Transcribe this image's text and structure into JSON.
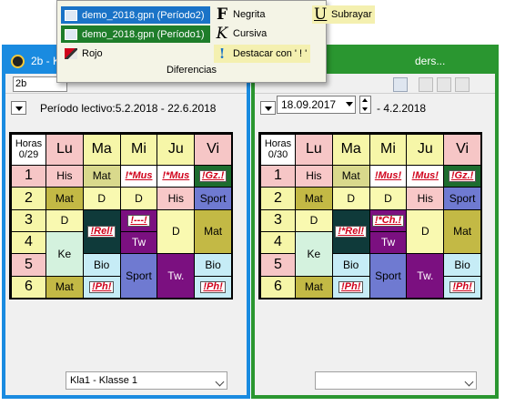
{
  "popup": {
    "files": [
      {
        "label": "demo_2018.gpn (Período2)",
        "bg": "#1a73c7"
      },
      {
        "label": "demo_2018.gpn (Período1)",
        "bg": "#1e7d2a"
      }
    ],
    "rojo_label": "Rojo",
    "formats": {
      "negrita": "Negrita",
      "cursiva": "Cursiva",
      "destacar": "Destacar con ' ! '",
      "subrayar": "Subrayar"
    },
    "icons": {
      "negrita": "F",
      "cursiva": "K",
      "subrayar": "U",
      "destacar": "!"
    },
    "caption": "Diferencias"
  },
  "left_window": {
    "title": "2b - K",
    "class_input": "2b",
    "period_text": "Período lectivo:5.2.2018 - 22.6.2018",
    "bottom_select": "Kla1 - Klasse 1",
    "accent": "#1a8be0"
  },
  "right_window": {
    "title": "ders...",
    "date_value": "18.09.2017",
    "date_suffix": "- 4.2.2018",
    "bottom_select": "",
    "accent": "#2a9630"
  },
  "timetable": {
    "days": [
      "Lu",
      "Ma",
      "Mi",
      "Ju",
      "Vi"
    ],
    "periods": [
      "1",
      "2",
      "3",
      "4",
      "5",
      "6"
    ],
    "day_colors": [
      "#f6c6c6",
      "#f6f6a8",
      "#f6f6a8",
      "#f6f6a8",
      "#f6c6c6"
    ],
    "period_colors": [
      "#f6c6c6",
      "#f6f6a8",
      "#f6f6a8",
      "#f6f6a8",
      "#f6c6c6",
      "#f6f6a8"
    ],
    "left_hours": "Horas\n0/29",
    "right_hours": "Horas\n0/30",
    "left_lessons": [
      {
        "day": 0,
        "start": 0,
        "span": 1,
        "text": "His",
        "bg": "#f8c8c8",
        "fg": "#000",
        "red": false
      },
      {
        "day": 1,
        "start": 0,
        "span": 1,
        "text": "Mat",
        "bg": "#d9d98c",
        "fg": "#000",
        "red": false
      },
      {
        "day": 2,
        "start": 0,
        "span": 1,
        "text": "!*Mus",
        "bg": "#ffffff",
        "fg": "#d0021b",
        "red": true
      },
      {
        "day": 3,
        "start": 0,
        "span": 1,
        "text": "!*Mus",
        "bg": "#ffffff",
        "fg": "#d0021b",
        "red": true
      },
      {
        "day": 4,
        "start": 0,
        "span": 1,
        "text": "!Gz.!",
        "bg": "#1d6d2f",
        "fg": "#d0021b",
        "red": true,
        "box": true
      },
      {
        "day": 0,
        "start": 1,
        "span": 1,
        "text": "Mat",
        "bg": "#c3b945",
        "fg": "#000",
        "red": false
      },
      {
        "day": 1,
        "start": 1,
        "span": 1,
        "text": "D",
        "bg": "#f9f9b0",
        "fg": "#000",
        "red": false
      },
      {
        "day": 2,
        "start": 1,
        "span": 1,
        "text": "D",
        "bg": "#f9f9b0",
        "fg": "#000",
        "red": false
      },
      {
        "day": 3,
        "start": 1,
        "span": 1,
        "text": "His",
        "bg": "#f8c8c8",
        "fg": "#000",
        "red": false
      },
      {
        "day": 4,
        "start": 1,
        "span": 1,
        "text": "Sport",
        "bg": "#6f7ad1",
        "fg": "#000",
        "red": false
      },
      {
        "day": 0,
        "start": 2,
        "span": 1,
        "text": "D",
        "bg": "#f9f9b0",
        "fg": "#000",
        "red": false
      },
      {
        "day": 1,
        "start": 2,
        "span": 2,
        "text": "!Rel!",
        "bg": "#0f3a3a",
        "fg": "#d0021b",
        "red": true,
        "box": true
      },
      {
        "day": 2,
        "start": 2,
        "span": 1,
        "text": "!---!",
        "bg": "#7b1080",
        "fg": "#d0021b",
        "red": true,
        "box": true
      },
      {
        "day": 3,
        "start": 2,
        "span": 2,
        "text": "D",
        "bg": "#f9f9b0",
        "fg": "#000",
        "red": false
      },
      {
        "day": 4,
        "start": 2,
        "span": 2,
        "text": "Mat",
        "bg": "#c3b945",
        "fg": "#000",
        "red": false
      },
      {
        "day": 0,
        "start": 3,
        "span": 2,
        "text": "Ke",
        "bg": "#d4f2de",
        "fg": "#000",
        "red": false
      },
      {
        "day": 2,
        "start": 3,
        "span": 1,
        "text": "Tw",
        "bg": "#7b1080",
        "fg": "#ffffff",
        "red": false
      },
      {
        "day": 1,
        "start": 4,
        "span": 1,
        "text": "Bio",
        "bg": "#c6ecf6",
        "fg": "#000",
        "red": false
      },
      {
        "day": 2,
        "start": 4,
        "span": 2,
        "text": "Sport",
        "bg": "#6f7ad1",
        "fg": "#000",
        "red": false
      },
      {
        "day": 3,
        "start": 4,
        "span": 2,
        "text": "Tw.",
        "bg": "#7b1080",
        "fg": "#ffffff",
        "red": false
      },
      {
        "day": 4,
        "start": 4,
        "span": 1,
        "text": "Bio",
        "bg": "#c6ecf6",
        "fg": "#000",
        "red": false
      },
      {
        "day": 0,
        "start": 5,
        "span": 1,
        "text": "Mat",
        "bg": "#c3b945",
        "fg": "#000",
        "red": false
      },
      {
        "day": 1,
        "start": 5,
        "span": 1,
        "text": "!Ph!",
        "bg": "#c6ecf6",
        "fg": "#d0021b",
        "red": true,
        "box": true
      },
      {
        "day": 4,
        "start": 5,
        "span": 1,
        "text": "!Ph!",
        "bg": "#c6ecf6",
        "fg": "#d0021b",
        "red": true,
        "box": true
      }
    ],
    "right_lessons": [
      {
        "day": 0,
        "start": 0,
        "span": 1,
        "text": "His",
        "bg": "#f8c8c8",
        "fg": "#000",
        "red": false
      },
      {
        "day": 1,
        "start": 0,
        "span": 1,
        "text": "Mat",
        "bg": "#d9d98c",
        "fg": "#000",
        "red": false
      },
      {
        "day": 2,
        "start": 0,
        "span": 1,
        "text": "!Mus!",
        "bg": "#ffffff",
        "fg": "#d0021b",
        "red": true
      },
      {
        "day": 3,
        "start": 0,
        "span": 1,
        "text": "!Mus!",
        "bg": "#ffffff",
        "fg": "#d0021b",
        "red": true
      },
      {
        "day": 4,
        "start": 0,
        "span": 1,
        "text": "!Gz.!",
        "bg": "#1d6d2f",
        "fg": "#d0021b",
        "red": true,
        "box": true
      },
      {
        "day": 0,
        "start": 1,
        "span": 1,
        "text": "Mat",
        "bg": "#c3b945",
        "fg": "#000",
        "red": false
      },
      {
        "day": 1,
        "start": 1,
        "span": 1,
        "text": "D",
        "bg": "#f9f9b0",
        "fg": "#000",
        "red": false
      },
      {
        "day": 2,
        "start": 1,
        "span": 1,
        "text": "D",
        "bg": "#f9f9b0",
        "fg": "#000",
        "red": false
      },
      {
        "day": 3,
        "start": 1,
        "span": 1,
        "text": "His",
        "bg": "#f8c8c8",
        "fg": "#000",
        "red": false
      },
      {
        "day": 4,
        "start": 1,
        "span": 1,
        "text": "Sport",
        "bg": "#6f7ad1",
        "fg": "#000",
        "red": false
      },
      {
        "day": 0,
        "start": 2,
        "span": 1,
        "text": "D",
        "bg": "#f9f9b0",
        "fg": "#000",
        "red": false
      },
      {
        "day": 1,
        "start": 2,
        "span": 2,
        "text": "!*Rel!",
        "bg": "#0f3a3a",
        "fg": "#d0021b",
        "red": true,
        "box": true
      },
      {
        "day": 2,
        "start": 2,
        "span": 1,
        "text": "!*Ch.!",
        "bg": "#7b1080",
        "fg": "#d0021b",
        "red": true,
        "box": true
      },
      {
        "day": 3,
        "start": 2,
        "span": 2,
        "text": "D",
        "bg": "#f9f9b0",
        "fg": "#000",
        "red": false
      },
      {
        "day": 4,
        "start": 2,
        "span": 2,
        "text": "Mat",
        "bg": "#c3b945",
        "fg": "#000",
        "red": false
      },
      {
        "day": 0,
        "start": 3,
        "span": 2,
        "text": "Ke",
        "bg": "#d4f2de",
        "fg": "#000",
        "red": false
      },
      {
        "day": 2,
        "start": 3,
        "span": 1,
        "text": "Tw",
        "bg": "#7b1080",
        "fg": "#ffffff",
        "red": false
      },
      {
        "day": 1,
        "start": 4,
        "span": 1,
        "text": "Bio",
        "bg": "#c6ecf6",
        "fg": "#000",
        "red": false
      },
      {
        "day": 2,
        "start": 4,
        "span": 2,
        "text": "Sport",
        "bg": "#6f7ad1",
        "fg": "#000",
        "red": false
      },
      {
        "day": 3,
        "start": 4,
        "span": 2,
        "text": "Tw.",
        "bg": "#7b1080",
        "fg": "#ffffff",
        "red": false
      },
      {
        "day": 4,
        "start": 4,
        "span": 1,
        "text": "Bio",
        "bg": "#c6ecf6",
        "fg": "#000",
        "red": false
      },
      {
        "day": 0,
        "start": 5,
        "span": 1,
        "text": "Mat",
        "bg": "#c3b945",
        "fg": "#000",
        "red": false
      },
      {
        "day": 1,
        "start": 5,
        "span": 1,
        "text": "!Ph!",
        "bg": "#c6ecf6",
        "fg": "#d0021b",
        "red": true,
        "box": true
      },
      {
        "day": 4,
        "start": 5,
        "span": 1,
        "text": "!Ph!",
        "bg": "#c6ecf6",
        "fg": "#d0021b",
        "red": true,
        "box": true
      }
    ]
  }
}
